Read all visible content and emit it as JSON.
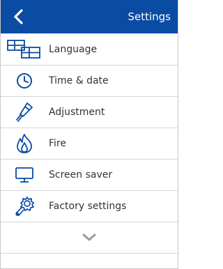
{
  "colors": {
    "header_bg": "#0a4ba3",
    "icon": "#0a4ba3",
    "divider": "#d6d6d6",
    "text": "#333333",
    "chevron": "#9a9a9a"
  },
  "header": {
    "back_icon": "chevron-left-icon",
    "title": "Settings"
  },
  "menu": {
    "items": [
      {
        "label": "Language",
        "icon": "language-icon"
      },
      {
        "label": "Time & date",
        "icon": "clock-icon"
      },
      {
        "label": "Adjustment",
        "icon": "adjustment-icon"
      },
      {
        "label": "Fire",
        "icon": "flame-icon"
      },
      {
        "label": "Screen saver",
        "icon": "monitor-icon"
      },
      {
        "label": "Factory settings",
        "icon": "gear-wrench-icon"
      }
    ],
    "more_icon": "chevron-down-icon"
  }
}
